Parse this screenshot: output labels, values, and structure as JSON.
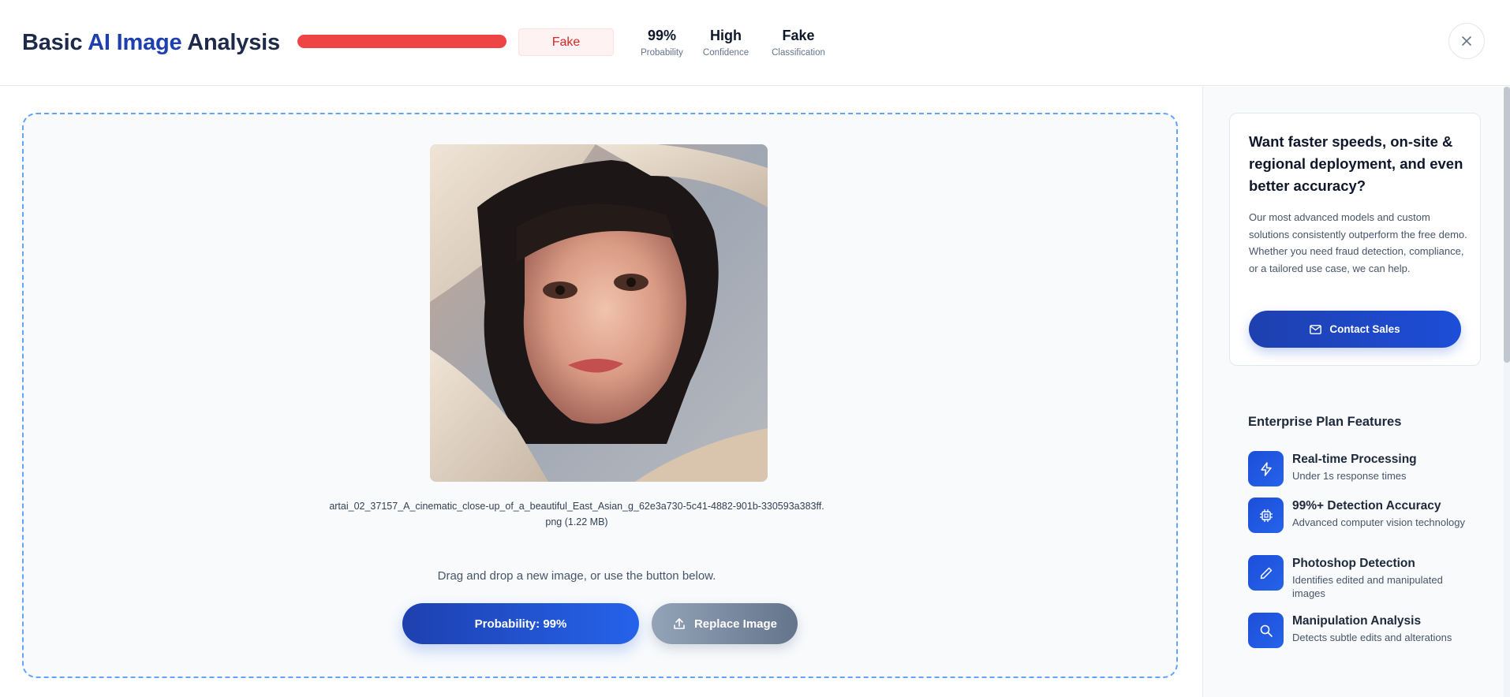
{
  "header": {
    "title_prefix": "Basic ",
    "title_ai": "AI Image",
    "title_suffix": " Analysis",
    "probability_bar_fraction": 0.99,
    "verdict": "Fake",
    "stats": [
      {
        "value": "99%",
        "label": "Probability"
      },
      {
        "value": "High",
        "label": "Confidence"
      },
      {
        "value": "Fake",
        "label": "Classification"
      }
    ],
    "close_icon": "close-icon"
  },
  "upload": {
    "filename_line1": "artai_02_37157_A_cinematic_close-up_of_a_beautiful_East_Asian_g_62e3a730-5c41-4882-901b-330593a383ff.",
    "filename_line2": "png (1.22 MB)",
    "hint": "Drag and drop a new image, or use the button below.",
    "probability_button": "Probability: 99%",
    "replace_button": "Replace Image",
    "replace_icon": "upload-icon"
  },
  "sidebar": {
    "promo_title": "Want faster speeds, on-site & regional deployment, and even better accuracy?",
    "promo_body": "Our most advanced models and custom solutions consistently outperform the free demo. Whether you need fraud detection, compliance, or a tailored use case, we can help.",
    "contact_button": "Contact Sales",
    "contact_icon": "mail-icon",
    "features_title": "Enterprise Plan Features",
    "features": [
      {
        "title": "Real-time Processing",
        "desc": "Under 1s response times",
        "icon": "lightning-icon"
      },
      {
        "title": "99%+ Detection Accuracy",
        "desc": "Advanced computer vision technology",
        "icon": "chip-icon"
      },
      {
        "title": "Photoshop Detection",
        "desc": "Identifies edited and manipulated images",
        "icon": "pencil-icon"
      },
      {
        "title": "Manipulation Analysis",
        "desc": "Detects subtle edits and alterations",
        "icon": "search-icon"
      }
    ]
  },
  "colors": {
    "accent": "#1e40af",
    "fake_red": "#ef4444",
    "dropzone_border": "#60a5fa"
  }
}
